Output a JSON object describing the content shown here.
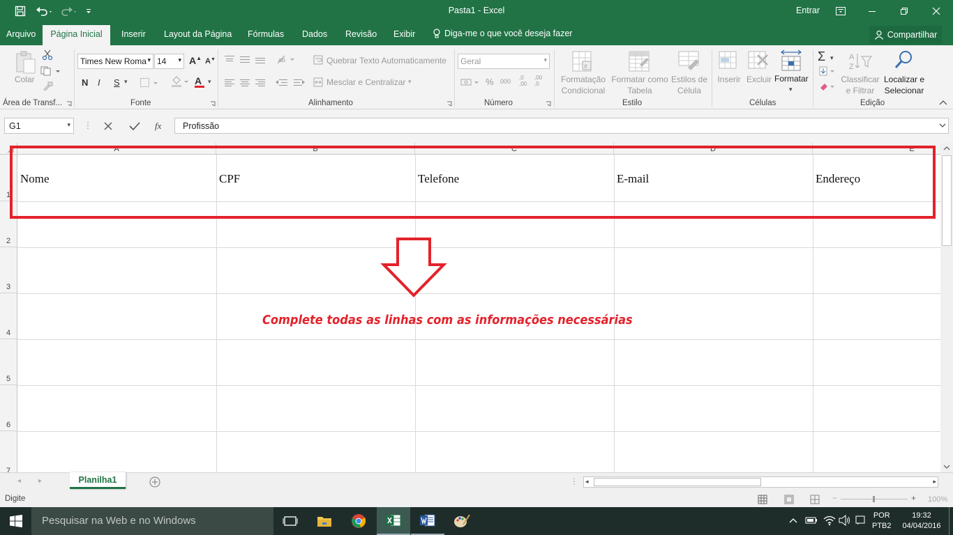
{
  "window": {
    "title": "Pasta1 - Excel",
    "signin": "Entrar"
  },
  "tabs": [
    {
      "label": "Arquivo"
    },
    {
      "label": "Página Inicial"
    },
    {
      "label": "Inserir"
    },
    {
      "label": "Layout da Página"
    },
    {
      "label": "Fórmulas"
    },
    {
      "label": "Dados"
    },
    {
      "label": "Revisão"
    },
    {
      "label": "Exibir"
    }
  ],
  "tell_me": "Diga-me o que você deseja fazer",
  "share": "Compartilhar",
  "ribbon": {
    "clipboard": {
      "paste": "Colar",
      "group": "Área de Transf..."
    },
    "font": {
      "name": "Times New Roma",
      "size": "14",
      "bold": "N",
      "italic": "I",
      "underline": "S",
      "grow": "A",
      "shrink": "A",
      "color_letter": "A",
      "group": "Fonte"
    },
    "alignment": {
      "wrap": "Quebrar Texto Automaticamente",
      "merge": "Mesclar e Centralizar",
      "group": "Alinhamento"
    },
    "number": {
      "format": "Geral",
      "percent": "%",
      "thousands": "000",
      "inc_decimal": ",0\n,00",
      "dec_decimal": ",00\n,0",
      "group": "Número"
    },
    "styles": {
      "conditional": "Formatação\nCondicional",
      "table": "Formatar como\nTabela",
      "cell": "Estilos de\nCélula",
      "group": "Estilo"
    },
    "cells": {
      "insert": "Inserir",
      "delete": "Excluir",
      "format": "Formatar",
      "group": "Células"
    },
    "editing": {
      "sort": "Classificar\ne Filtrar",
      "find": "Localizar e\nSelecionar",
      "sum": "Σ",
      "group": "Edição"
    }
  },
  "formula_bar": {
    "name_box": "G1",
    "fx": "fx",
    "value": "Profissão"
  },
  "grid": {
    "columns": [
      "A",
      "B",
      "C",
      "D",
      "E"
    ],
    "rows": [
      "1",
      "2",
      "3",
      "4",
      "5",
      "6",
      "7"
    ],
    "row1": [
      "Nome",
      "CPF",
      "Telefone",
      "E-mail",
      "Endereço"
    ]
  },
  "annotation": {
    "text": "Complete todas as linhas com as informações necessárias",
    "color": "#e3222b"
  },
  "sheets": [
    {
      "label": "Planilha1"
    }
  ],
  "status": {
    "mode": "Digite",
    "zoom": "100%"
  },
  "taskbar": {
    "search": "Pesquisar na Web e no Windows",
    "lang1": "POR",
    "lang2": "PTB2",
    "time": "19:32",
    "date": "04/04/2016"
  },
  "colors": {
    "accent": "#217346",
    "highlight": "#e3222b"
  }
}
